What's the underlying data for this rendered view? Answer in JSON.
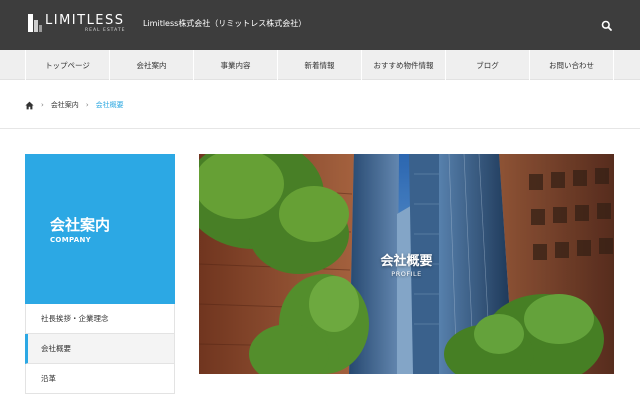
{
  "header": {
    "logo_word": "LIMITLESS",
    "logo_sub": "REAL ESTATE",
    "company_name": "Limitless株式会社（リミットレス株式会社）",
    "search_icon": "search-icon"
  },
  "nav": {
    "items": [
      {
        "label": "トップページ"
      },
      {
        "label": "会社案内"
      },
      {
        "label": "事業内容"
      },
      {
        "label": "新着情報"
      },
      {
        "label": "おすすめ物件情報"
      },
      {
        "label": "ブログ"
      },
      {
        "label": "お問い合わせ"
      }
    ]
  },
  "breadcrumb": {
    "home_icon": "home-icon",
    "separator": "›",
    "items": [
      "会社案内",
      "会社概要"
    ]
  },
  "sidebar": {
    "title": "会社案内",
    "subtitle": "COMPANY",
    "items": [
      {
        "label": "社長挨拶・企業理念"
      },
      {
        "label": "会社概要"
      },
      {
        "label": "沿革"
      }
    ]
  },
  "hero": {
    "title": "会社概要",
    "subtitle": "PROFILE"
  },
  "colors": {
    "header_bg": "#3d3d3d",
    "accent": "#2ca8e4",
    "nav_bg": "#efefef"
  }
}
